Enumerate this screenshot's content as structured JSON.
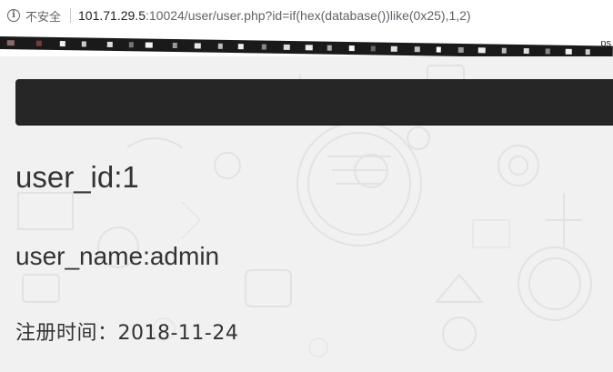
{
  "browser": {
    "security_icon": "info-icon",
    "security_label": "不安全",
    "url_host": "101.71.29.5",
    "url_rest": ":10024/user/user.php?id=if(hex(database())like(0x25),1,2)"
  },
  "bookmarks": {
    "trailing_text": "ps"
  },
  "navbar": {
    "color": "#262626"
  },
  "profile": {
    "user_id_text": "user_id:1",
    "user_name_text": "user_name:admin",
    "reg_time_text": "注册时间：2018-11-24"
  }
}
